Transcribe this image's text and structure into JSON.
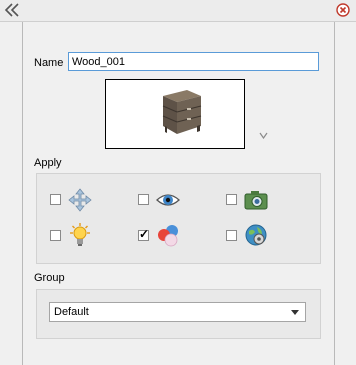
{
  "name": {
    "label": "Name",
    "value": "Wood_001"
  },
  "apply": {
    "label": "Apply",
    "options": [
      {
        "icon": "move-arrows-icon",
        "checked": false
      },
      {
        "icon": "eye-icon",
        "checked": false
      },
      {
        "icon": "camera-icon",
        "checked": false
      },
      {
        "icon": "light-bulb-icon",
        "checked": false
      },
      {
        "icon": "color-spheres-icon",
        "checked": true,
        "check_mark": "✓"
      },
      {
        "icon": "globe-settings-icon",
        "checked": false
      }
    ]
  },
  "group": {
    "label": "Group",
    "selected": "Default"
  },
  "colors": {
    "input_border": "#5a9bd8",
    "close": "#c0392b"
  }
}
